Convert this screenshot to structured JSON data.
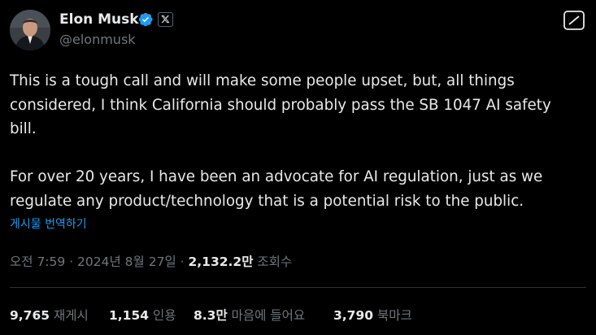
{
  "author": {
    "name": "Elon Musk",
    "handle": "@elonmusk",
    "avatar_icon": "avatar-photo",
    "verified_icon": "verified-badge-icon",
    "affiliation_icon": "x-logo-icon",
    "verified_color": "#1d9bf0"
  },
  "grok_icon": "grok-icon",
  "tweet": {
    "text": "This is a tough call and will make some people upset, but, all things\nconsidered, I think California should probably pass the SB 1047 AI safety\nbill.\n\nFor over 20 years, I have been an advocate for AI regulation, just as we\nregulate any product/technology that is a potential risk to the public."
  },
  "translate_label": "게시물 번역하기",
  "meta": {
    "time": "오전 7:59",
    "sep1": " · ",
    "date": "2024년 8월 27일",
    "sep2": " · ",
    "views_count": "2,132.2만",
    "views_label": " 조회수"
  },
  "stats": {
    "reposts": {
      "count": "9,765",
      "label": " 재게시"
    },
    "quotes": {
      "count": "1,154",
      "label": " 인용"
    },
    "likes": {
      "count": "8.3만",
      "label": " 마음에 들어요"
    },
    "bookmarks": {
      "count": "3,790",
      "label": " 북마크"
    }
  },
  "colors": {
    "background": "#000000",
    "text": "#e7e9ea",
    "secondary": "#71767b",
    "link": "#1d9bf0",
    "divider": "#2f3336"
  }
}
